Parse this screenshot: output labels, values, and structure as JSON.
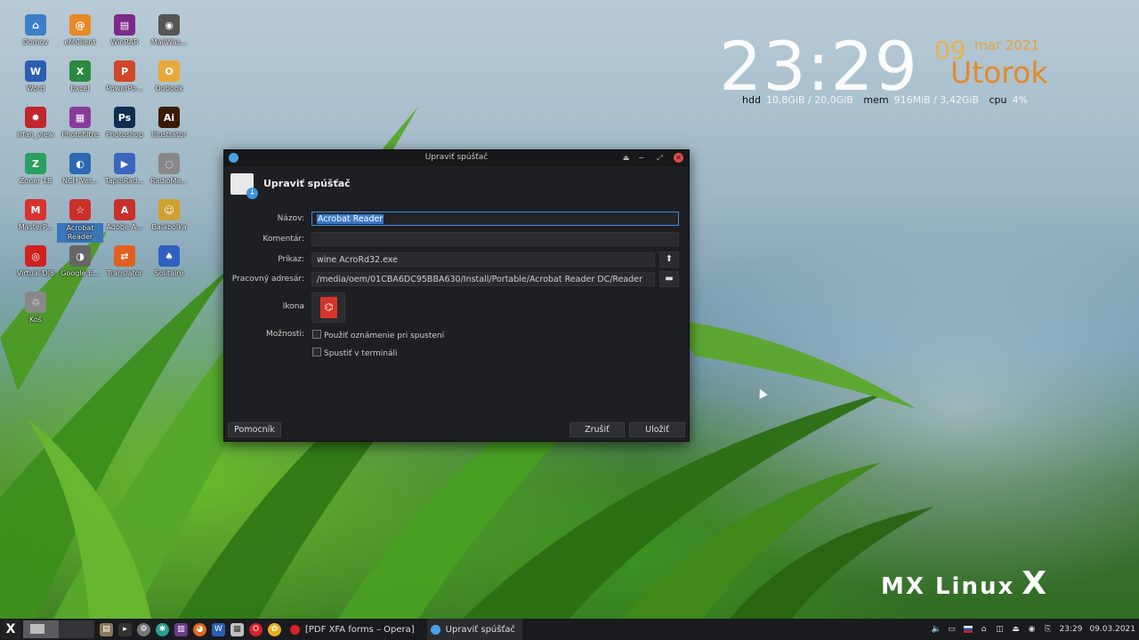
{
  "desktop": {
    "icons": [
      {
        "label": "Domov",
        "glyph": "⌂",
        "color": "#3d7fc6"
      },
      {
        "label": "eMClient",
        "glyph": "@",
        "color": "#e78a2a"
      },
      {
        "label": "WinRAR",
        "glyph": "▤",
        "color": "#7b2a8a"
      },
      {
        "label": "MailWas...",
        "glyph": "◉",
        "color": "#555555"
      },
      {
        "label": "Word",
        "glyph": "W",
        "color": "#2b5eb3"
      },
      {
        "label": "Excel",
        "glyph": "X",
        "color": "#2a8a3e"
      },
      {
        "label": "PowerPo...",
        "glyph": "P",
        "color": "#d2472a"
      },
      {
        "label": "Outlook",
        "glyph": "O",
        "color": "#e8a93a"
      },
      {
        "label": "Irfan_view",
        "glyph": "✹",
        "color": "#c0262c"
      },
      {
        "label": "Photofiltre",
        "glyph": "▦",
        "color": "#8a3a9a"
      },
      {
        "label": "Photoshop",
        "glyph": "Ps",
        "color": "#0f2d4f"
      },
      {
        "label": "Illustrator",
        "glyph": "Ai",
        "color": "#3a1a05"
      },
      {
        "label": "Zoner 18",
        "glyph": "Z",
        "color": "#2aa060"
      },
      {
        "label": "NCH Ver...",
        "glyph": "◐",
        "color": "#2d68b0"
      },
      {
        "label": "TapinRad...",
        "glyph": "▶",
        "color": "#3b66c0"
      },
      {
        "label": "RadioMa...",
        "glyph": "◌",
        "color": "#888888"
      },
      {
        "label": "MasterP...",
        "glyph": "M",
        "color": "#d93030"
      },
      {
        "label": "Acrobat Reader",
        "glyph": "☆",
        "color": "#c9302a",
        "selected": true
      },
      {
        "label": "Adobe A...",
        "glyph": "A",
        "color": "#c9302a"
      },
      {
        "label": "Balabolka",
        "glyph": "☺",
        "color": "#d0a030"
      },
      {
        "label": "Virtual DJ8",
        "glyph": "◎",
        "color": "#d02020"
      },
      {
        "label": "Google E...",
        "glyph": "◑",
        "color": "#666666"
      },
      {
        "label": "Translator",
        "glyph": "⇄",
        "color": "#e06020"
      },
      {
        "label": "Solitaire",
        "glyph": "♠",
        "color": "#3060c0"
      },
      {
        "label": "Koš",
        "glyph": "♲",
        "color": "#888888"
      }
    ]
  },
  "conky": {
    "time": "23:29",
    "day": "09",
    "month_year": "mar 2021",
    "weekday": "Utorok",
    "hdd_label": "hdd",
    "hdd_value": "10,8GiB / 20,0GiB",
    "mem_label": "mem",
    "mem_value": "916MiB / 3,42GiB",
    "cpu_label": "cpu",
    "cpu_value": "4%"
  },
  "branding": {
    "logo_text": "MX Linux",
    "logo_mark": "X"
  },
  "dialog": {
    "window_title": "Upraviť spúšťač",
    "header_title": "Upraviť spúšťač",
    "window_buttons": {
      "shade": "⏏",
      "minimize": "−",
      "maximize": "⤢",
      "close": "✕"
    },
    "fields": {
      "name_label": "Názov:",
      "name_value": "Acrobat Reader",
      "comment_label": "Komentár:",
      "comment_value": "",
      "command_label": "Príkaz:",
      "command_value": "wine AcroRd32.exe",
      "workdir_label": "Pracovný adresár:",
      "workdir_value": "/media/oem/01CBA6DC95BBA630/Install/Portable/Acrobat Reader DC/Reader",
      "icon_label": "Ikona",
      "options_label": "Možnosti:"
    },
    "options": [
      {
        "label": "Použiť oznámenie pri spustení",
        "checked": false
      },
      {
        "label": "Spustiť v termináli",
        "checked": false
      }
    ],
    "buttons": {
      "help": "Pomocník",
      "cancel": "Zrušiť",
      "save": "Uložiť"
    }
  },
  "taskbar": {
    "start_glyph": "X",
    "tasks": [
      {
        "label": "[PDF XFA forms – Opera]",
        "color": "#d8222a",
        "active": false
      },
      {
        "label": "Upraviť spúšťač",
        "color": "#4aa0e6",
        "active": true
      }
    ],
    "clock_time": "23:29",
    "clock_date": "09.03.2021"
  },
  "colors": {
    "accent": "#3b8fe0",
    "dialog_bg": "#1e1f22",
    "conky_orange": "#e38a2a"
  }
}
